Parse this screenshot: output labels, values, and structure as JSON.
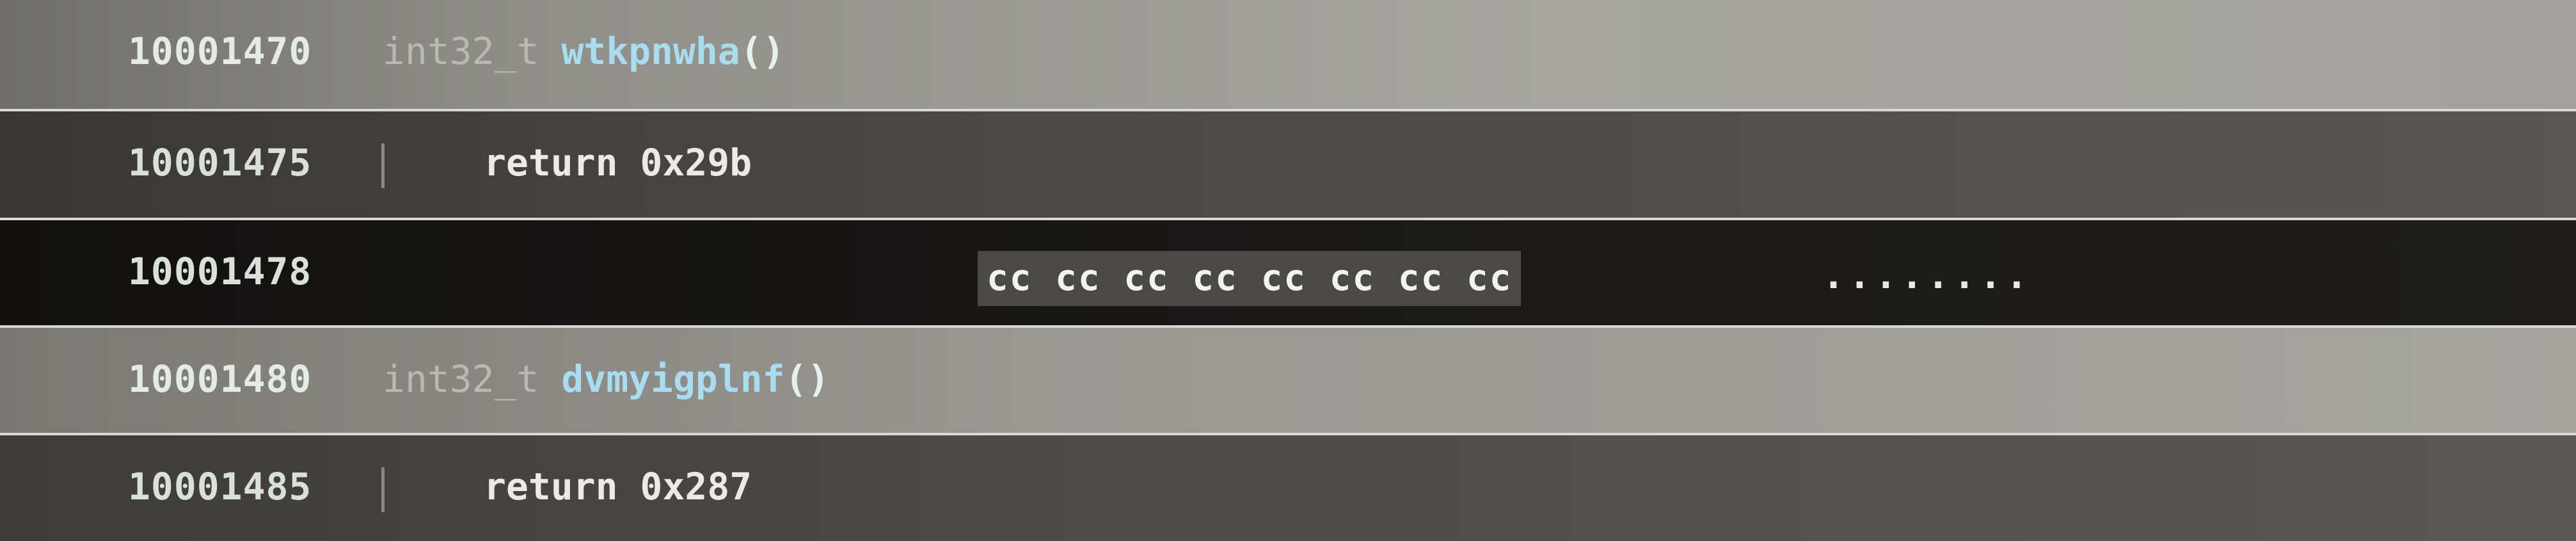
{
  "rows": [
    {
      "address": "10001470",
      "type": "int32_t",
      "name": "wtkpnwha",
      "parens": "()"
    },
    {
      "address": "10001475",
      "statement": "return 0x29b"
    },
    {
      "address": "10001478",
      "bytes": "cc cc cc cc cc cc cc cc",
      "ascii": "........"
    },
    {
      "address": "10001480",
      "type": "int32_t",
      "name": "dvmyigplnf",
      "parens": "()"
    },
    {
      "address": "10001485",
      "statement": "return 0x287"
    }
  ],
  "colors": {
    "function_name": "#a9dcef",
    "type": "#b9b8b2",
    "address": "#d8e0d8",
    "byte_highlight": "#4b4946"
  }
}
